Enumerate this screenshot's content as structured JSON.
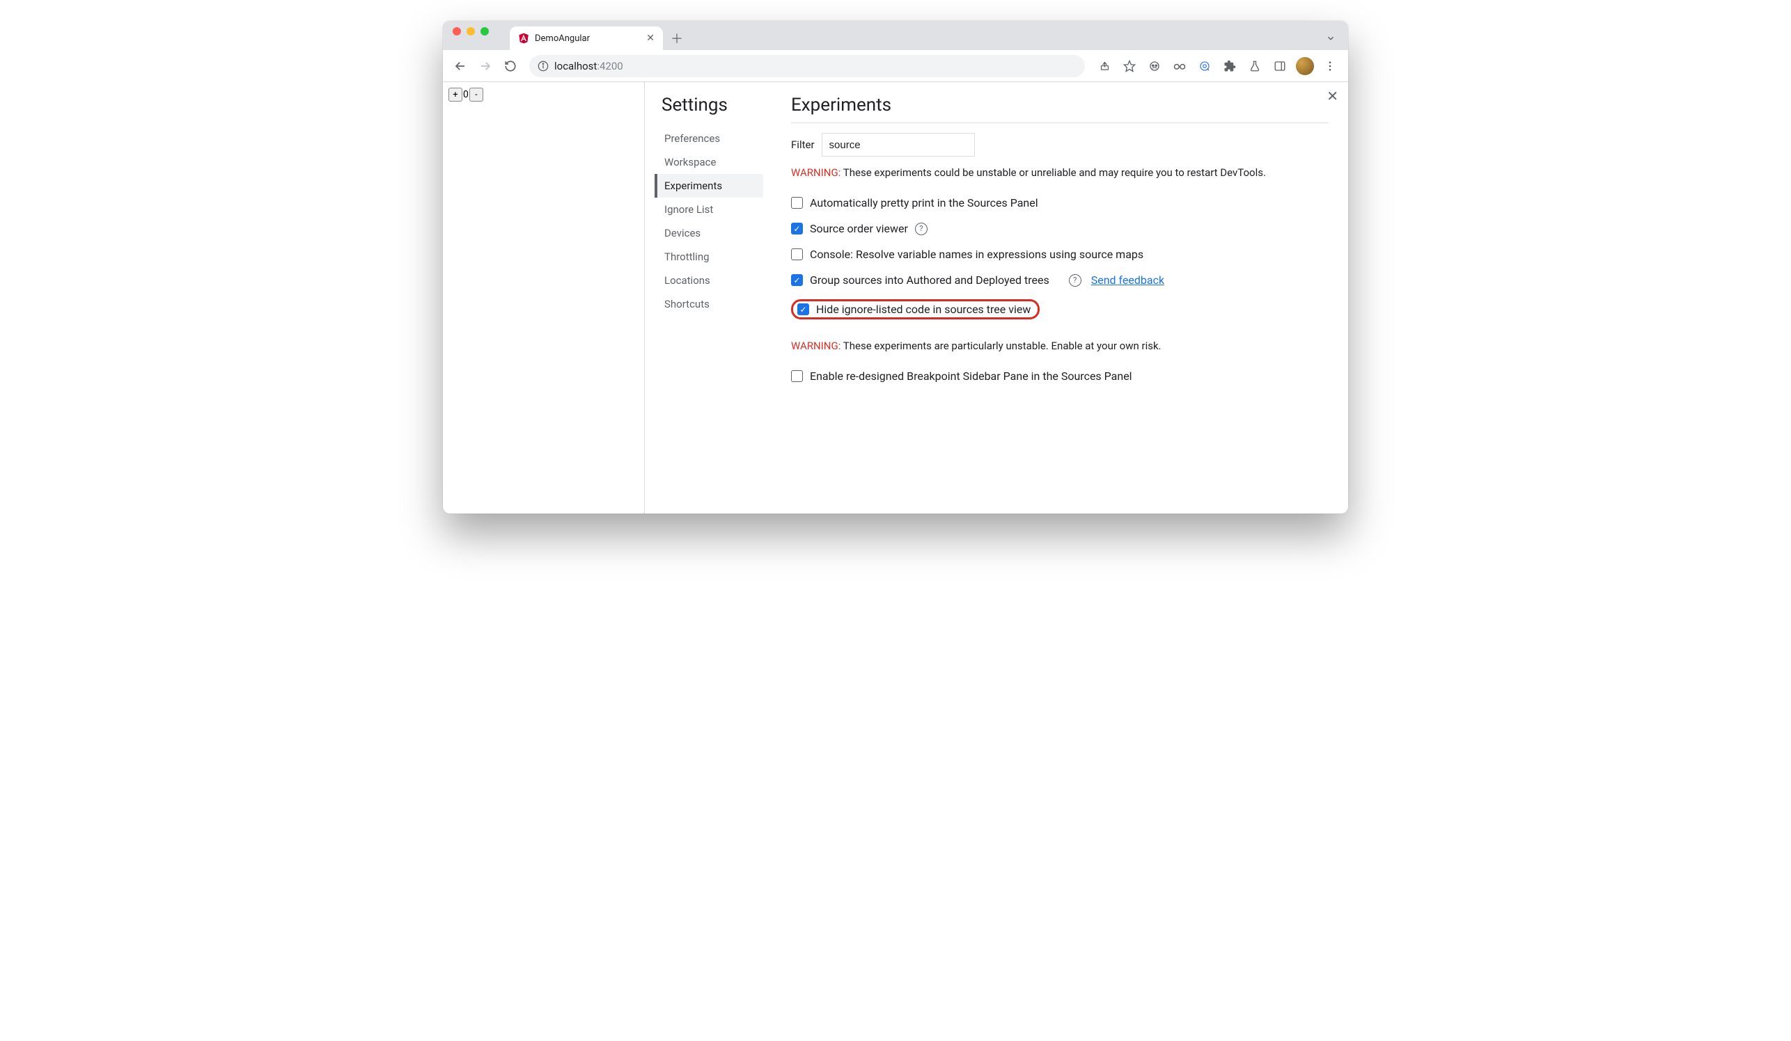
{
  "tab": {
    "title": "DemoAngular"
  },
  "url": {
    "host": "localhost",
    "port": ":4200"
  },
  "page": {
    "counter_value": "0"
  },
  "settings": {
    "title": "Settings",
    "nav": [
      {
        "label": "Preferences"
      },
      {
        "label": "Workspace"
      },
      {
        "label": "Experiments"
      },
      {
        "label": "Ignore List"
      },
      {
        "label": "Devices"
      },
      {
        "label": "Throttling"
      },
      {
        "label": "Locations"
      },
      {
        "label": "Shortcuts"
      }
    ]
  },
  "experiments": {
    "title": "Experiments",
    "filter_label": "Filter",
    "filter_value": "source",
    "warning1_label": "WARNING:",
    "warning1_text": " These experiments could be unstable or unreliable and may require you to restart DevTools.",
    "warning2_label": "WARNING:",
    "warning2_text": " These experiments are particularly unstable. Enable at your own risk.",
    "feedback": "Send feedback",
    "items": [
      {
        "label": "Automatically pretty print in the Sources Panel",
        "checked": false,
        "help": false
      },
      {
        "label": "Source order viewer",
        "checked": true,
        "help": true
      },
      {
        "label": "Console: Resolve variable names in expressions using source maps",
        "checked": false,
        "help": false
      },
      {
        "label": "Group sources into Authored and Deployed trees",
        "checked": true,
        "help": true,
        "feedback": true
      },
      {
        "label": "Hide ignore-listed code in sources tree view",
        "checked": true,
        "help": false,
        "highlight": true
      }
    ],
    "unstable": [
      {
        "label": "Enable re-designed Breakpoint Sidebar Pane in the Sources Panel",
        "checked": false
      }
    ]
  }
}
